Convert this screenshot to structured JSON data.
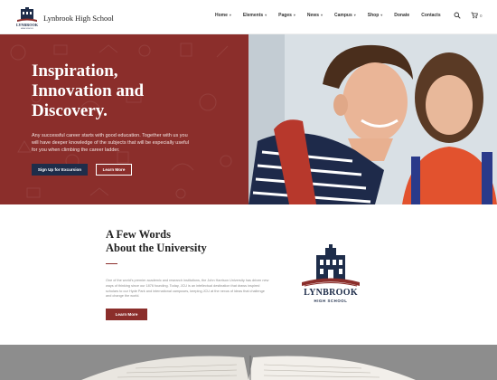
{
  "site": {
    "name": "Lynbrook High School",
    "logo_icon": "school-building-logo"
  },
  "nav": {
    "items": [
      {
        "label": "Home",
        "has_caret": true
      },
      {
        "label": "Elements",
        "has_caret": true
      },
      {
        "label": "Pages",
        "has_caret": true
      },
      {
        "label": "News",
        "has_caret": true
      },
      {
        "label": "Campus",
        "has_caret": true
      },
      {
        "label": "Shop",
        "has_caret": true
      },
      {
        "label": "Donate",
        "has_caret": false
      },
      {
        "label": "Contacts",
        "has_caret": false
      }
    ],
    "caret": "▾",
    "search_icon": "search-icon",
    "cart_icon": "cart-icon",
    "cart_count": "0"
  },
  "hero": {
    "title_line1": "Inspiration,",
    "title_line2": "Innovation and",
    "title_line3": "Discovery.",
    "text": "Any successful career starts with good education. Together with us you will have deeper knowledge of the subjects that will be especially useful for you when climbing the career ladder.",
    "primary_button": "Sign Up for Excursion",
    "secondary_button": "Learn More"
  },
  "about": {
    "title_line1": "A Few Words",
    "title_line2": "About the University",
    "text": "One of the world's premier academic and research institutions, the John Harrison University has driven new ways of thinking since our 1876 founding. Today, JCU is an intellectual destination that draws inspired scholars to our Hyde Park and international campuses, keeping JCU at the nexus of ideas that challenge and change the world.",
    "button": "Learn More"
  },
  "emblem": {
    "name": "LYNBROOK",
    "subtitle": "HIGH SCHOOL"
  },
  "colors": {
    "brand_red": "#8b2e2b",
    "navy": "#1e2d4a"
  }
}
